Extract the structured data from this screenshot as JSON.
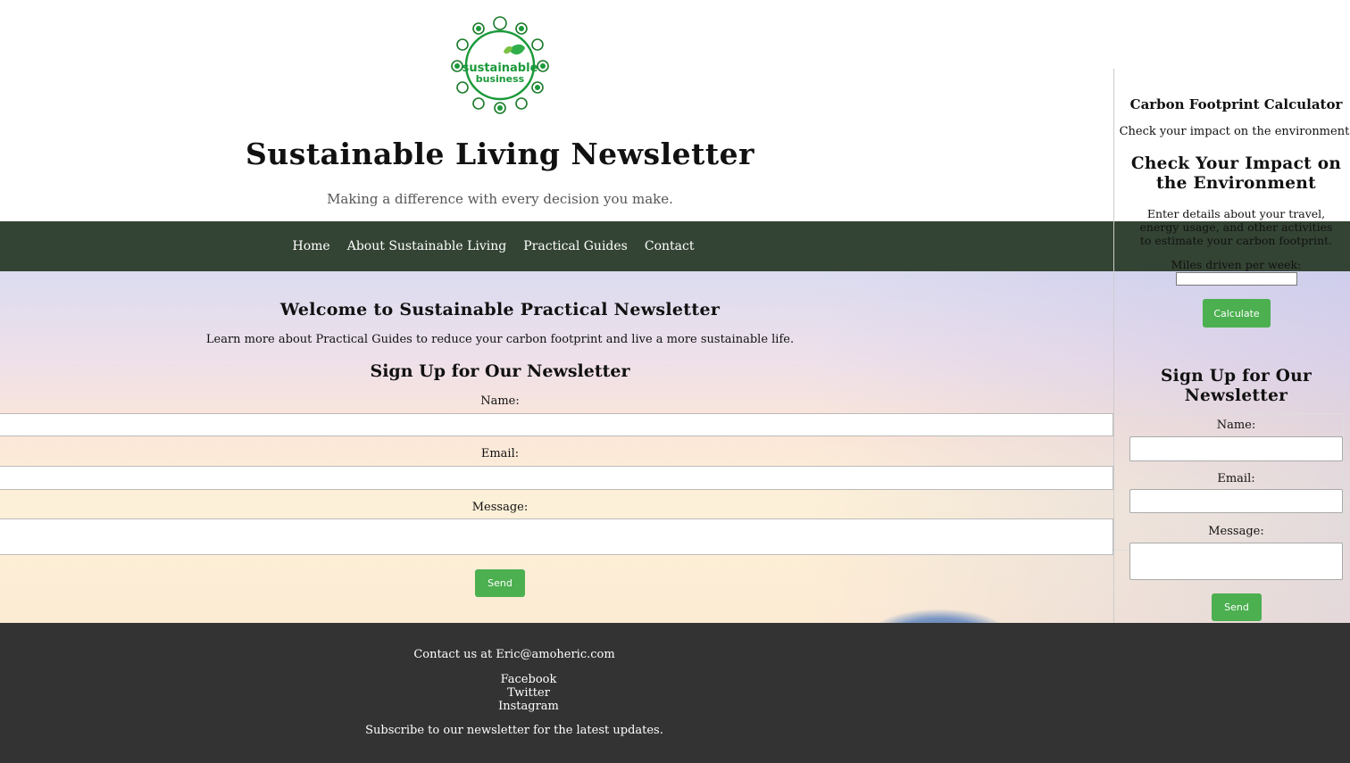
{
  "header": {
    "logo_text_top": "sustainable",
    "logo_text_bottom": "business",
    "title": "Sustainable Living Newsletter",
    "tagline": "Making a difference with every decision you make."
  },
  "nav": {
    "items": [
      "Home",
      "About Sustainable Living",
      "Practical Guides",
      "Contact"
    ]
  },
  "main": {
    "welcome_title": "Welcome to Sustainable Practical Newsletter",
    "welcome_text": "Learn more about Practical Guides to reduce your carbon footprint and live a more sustainable life.",
    "signup_title": "Sign Up for Our Newsletter",
    "name_label": "Name:",
    "email_label": "Email:",
    "message_label": "Message:",
    "send_label": "Send"
  },
  "sidebar": {
    "calc_title": "Carbon Footprint Calculator",
    "calc_subtitle": "Check your impact on the environment.",
    "check_title": "Check Your Impact on the Environment",
    "enter_details": "Enter details about your travel, energy usage, and other activities to estimate your carbon footprint.",
    "miles_label": "Miles driven per week:",
    "calculate_label": "Calculate",
    "signup_title": "Sign Up for Our Newsletter",
    "name_label": "Name:",
    "email_label": "Email:",
    "message_label": "Message:",
    "send_label": "Send"
  },
  "footer": {
    "contact": "Contact us at Eric@amoheric.com",
    "social": [
      "Facebook",
      "Twitter",
      "Instagram"
    ],
    "subscribe": "Subscribe to our newsletter for the latest updates."
  },
  "colors": {
    "nav_bg": "#344434",
    "footer_bg": "#333333",
    "button_green": "#4caf50"
  }
}
